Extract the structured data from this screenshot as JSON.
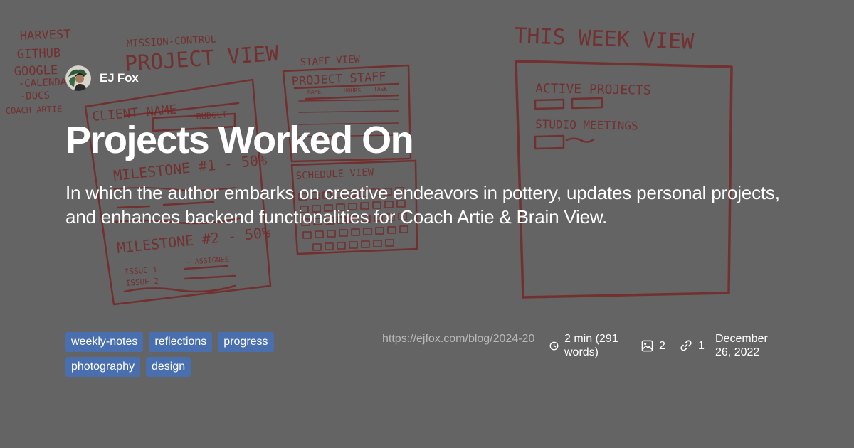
{
  "author": {
    "name": "EJ Fox",
    "avatar_icon": "avatar"
  },
  "post": {
    "title": "Projects Worked On",
    "description": "In which the author embarks on creative endeavors in pottery, updates personal projects, and enhances backend functionalities for Coach Artie & Brain View."
  },
  "tags": [
    "weekly-notes",
    "reflections",
    "progress",
    "photography",
    "design"
  ],
  "meta": {
    "url": "https://ejfox.com/blog/2024-20",
    "reading_time": "2 min (291 words)",
    "reading_time_icon": "clock-icon",
    "image_count": "2",
    "image_icon": "image-icon",
    "link_count": "1",
    "link_icon": "link-icon",
    "date": "December 26, 2022"
  },
  "background_sketch": {
    "list": [
      "HARVEST",
      "GITHUB",
      "GOOGLE",
      "-CALENDAR",
      "-DOCS",
      "COACH ARTIE"
    ],
    "project_view_header": "MISSION-CONTROL",
    "project_view_title": "PROJECT VIEW",
    "client_name": "CLIENT NAME",
    "budget": "BUDGET",
    "milestone_1": "MILESTONE #1 - 50%",
    "milestone_2": "MILESTONE #2 - 50%",
    "issue_1": "ISSUE 1",
    "issue_2": "ISSUE 2",
    "assignee": "- ASSIGNEE",
    "staff_view": "STAFF VIEW",
    "project_staff": "PROJECT STAFF",
    "staff_cols": [
      "NAME",
      "HOURS",
      "TASK"
    ],
    "schedule_view": "SCHEDULE VIEW",
    "this_week_view": "THIS WEEK VIEW",
    "active_projects": "ACTIVE PROJECTS",
    "studio_meetings": "STUDIO MEETINGS"
  },
  "colors": {
    "background": "#646464",
    "tag_background": "#4a6fae",
    "sketch_ink": "#7a1a1a",
    "url_text": "#b9b9b9",
    "text": "#ffffff"
  }
}
